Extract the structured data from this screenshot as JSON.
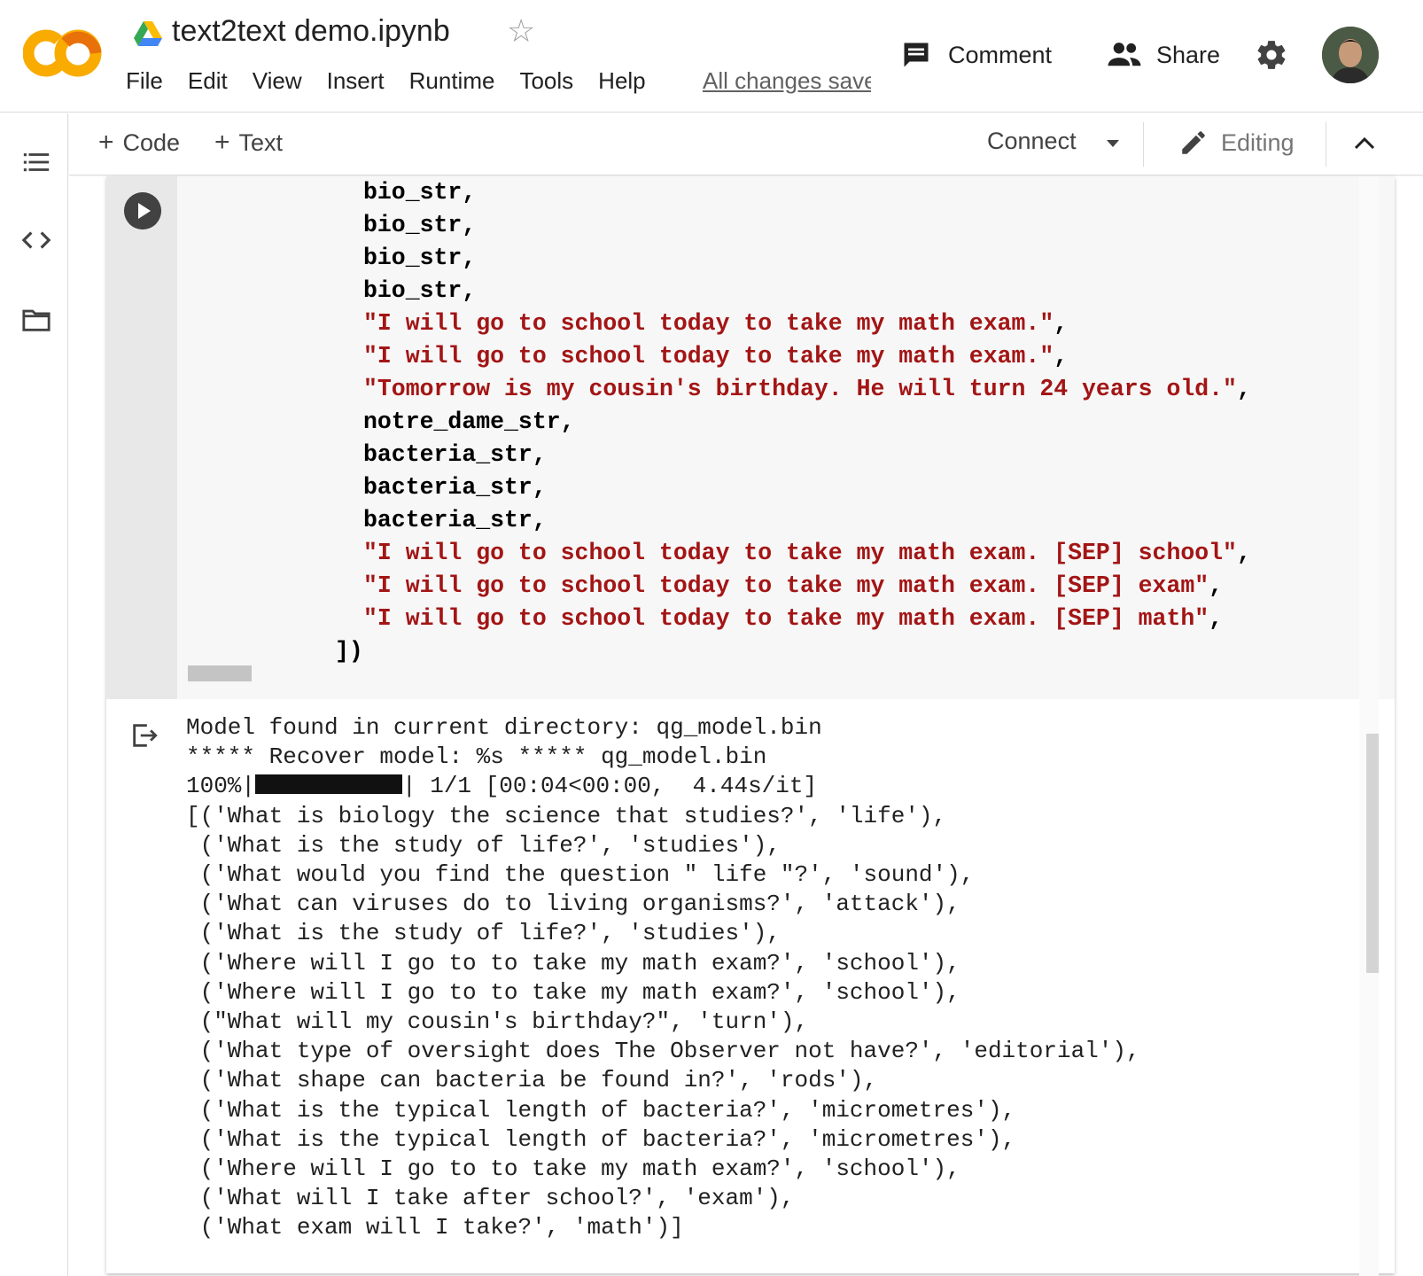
{
  "header": {
    "title": "text2text demo.ipynb",
    "saved_status": "All changes saved",
    "comment_label": "Comment",
    "share_label": "Share"
  },
  "menu": [
    "File",
    "Edit",
    "View",
    "Insert",
    "Runtime",
    "Tools",
    "Help"
  ],
  "toolbar": {
    "code_label": "Code",
    "text_label": "Text",
    "connect_label": "Connect",
    "editing_label": "Editing"
  },
  "code_lines": [
    {
      "text": "bio_str,",
      "type": "plain"
    },
    {
      "text": "bio_str,",
      "type": "plain"
    },
    {
      "text": "bio_str,",
      "type": "plain"
    },
    {
      "text": "bio_str,",
      "type": "plain"
    },
    {
      "text": "\"I will go to school today to take my math exam.\"",
      "type": "str",
      "suffix": ","
    },
    {
      "text": "\"I will go to school today to take my math exam.\"",
      "type": "str",
      "suffix": ","
    },
    {
      "text": "\"Tomorrow is my cousin's birthday. He will turn 24 years old.\"",
      "type": "str",
      "suffix": ","
    },
    {
      "text": "notre_dame_str,",
      "type": "plain"
    },
    {
      "text": "bacteria_str,",
      "type": "plain"
    },
    {
      "text": "bacteria_str,",
      "type": "plain"
    },
    {
      "text": "bacteria_str,",
      "type": "plain"
    },
    {
      "text": "\"I will go to school today to take my math exam. [SEP] school\"",
      "type": "str",
      "suffix": ","
    },
    {
      "text": "\"I will go to school today to take my math exam. [SEP] exam\"",
      "type": "str",
      "suffix": ","
    },
    {
      "text": "\"I will go to school today to take my math exam. [SEP] math\"",
      "type": "str",
      "suffix": ","
    }
  ],
  "code_closing": "])",
  "output": {
    "line1": "Model found in current directory: qg_model.bin",
    "line2": "***** Recover model: %s ***** qg_model.bin",
    "progress_prefix": "100%|",
    "progress_suffix": "| 1/1 [00:04<00:00,  4.44s/it]",
    "progress_percent": 100,
    "results": [
      "[('What is biology the science that studies?', 'life'),",
      " ('What is the study of life?', 'studies'),",
      " ('What would you find the question \" life \"?', 'sound'),",
      " ('What can viruses do to living organisms?', 'attack'),",
      " ('What is the study of life?', 'studies'),",
      " ('Where will I go to to take my math exam?', 'school'),",
      " ('Where will I go to to take my math exam?', 'school'),",
      " (\"What will my cousin's birthday?\", 'turn'),",
      " ('What type of oversight does The Observer not have?', 'editorial'),",
      " ('What shape can bacteria be found in?', 'rods'),",
      " ('What is the typical length of bacteria?', 'micrometres'),",
      " ('What is the typical length of bacteria?', 'micrometres'),",
      " ('Where will I go to to take my math exam?', 'school'),",
      " ('What will I take after school?', 'exam'),",
      " ('What exam will I take?', 'math')]"
    ]
  },
  "colors": {
    "string": "#a31515",
    "logo_orange": "#f9ab00",
    "logo_dark_orange": "#e8710a"
  }
}
